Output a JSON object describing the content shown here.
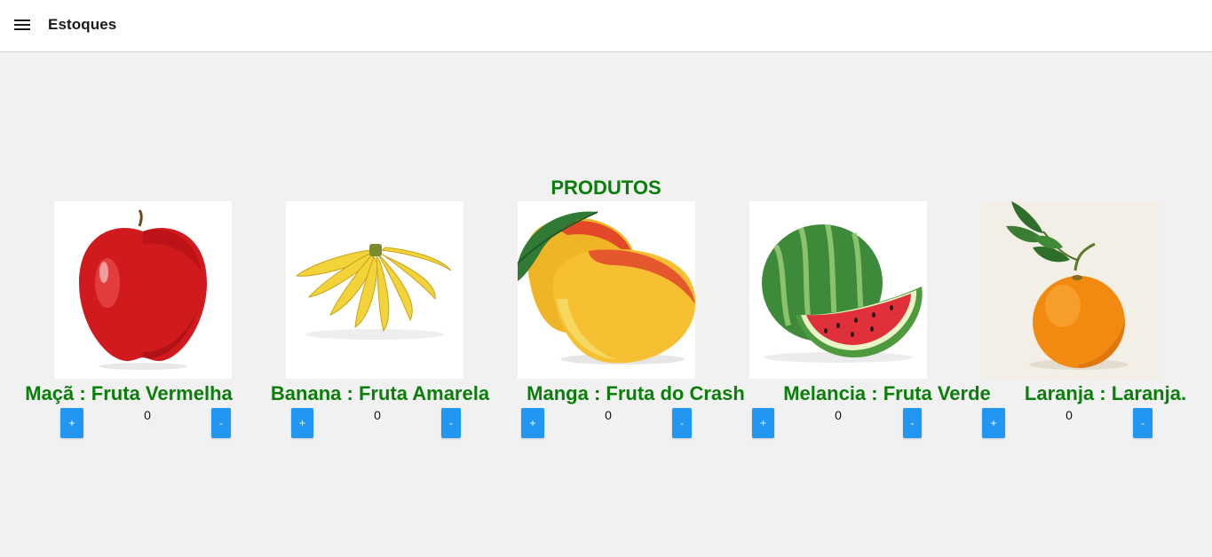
{
  "app": {
    "title": "Estoques"
  },
  "section": {
    "title": "PRODUTOS"
  },
  "colors": {
    "accent_green": "#0a7d0a",
    "button_blue": "#2196f3",
    "background": "#f1f1f1"
  },
  "products": [
    {
      "label": "Maçã : Fruta Vermelha",
      "quantity": "0",
      "plus_label": "+",
      "minus_label": "-",
      "image_icon": "apple-image"
    },
    {
      "label": "Banana : Fruta Amarela",
      "quantity": "0",
      "plus_label": "+",
      "minus_label": "-",
      "image_icon": "banana-image"
    },
    {
      "label": "Manga : Fruta do Crash",
      "quantity": "0",
      "plus_label": "+",
      "minus_label": "-",
      "image_icon": "mango-image"
    },
    {
      "label": "Melancia : Fruta Verde",
      "quantity": "0",
      "plus_label": "+",
      "minus_label": "-",
      "image_icon": "watermelon-image"
    },
    {
      "label": "Laranja : Laranja.",
      "quantity": "0",
      "plus_label": "+",
      "minus_label": "-",
      "image_icon": "orange-image"
    }
  ]
}
